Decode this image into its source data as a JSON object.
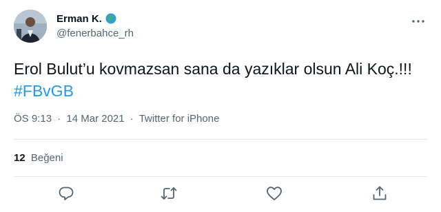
{
  "author": {
    "display_name": "Erman K.",
    "handle": "@fenerbahce_rh",
    "avatar_icon": "profile-photo",
    "badge_icon": "globe-icon"
  },
  "tweet": {
    "text": "Erol Bulut’u kovmazsan sana da yazıklar olsun Ali Koç.!!!",
    "hashtag": "#FBvGB"
  },
  "meta": {
    "time": "ÖS 9:13",
    "separator": "·",
    "date": "14 Mar 2021",
    "source": "Twitter for iPhone"
  },
  "stats": {
    "like_count": "12",
    "like_label": "Beğeni"
  },
  "actions": {
    "reply_icon": "reply-icon",
    "retweet_icon": "retweet-icon",
    "like_icon": "heart-icon",
    "share_icon": "share-icon",
    "more_icon": "more-icon"
  },
  "colors": {
    "link": "#1d9bf0",
    "text": "#0f1419",
    "secondary": "#536471",
    "divider": "#e1e8ed"
  }
}
